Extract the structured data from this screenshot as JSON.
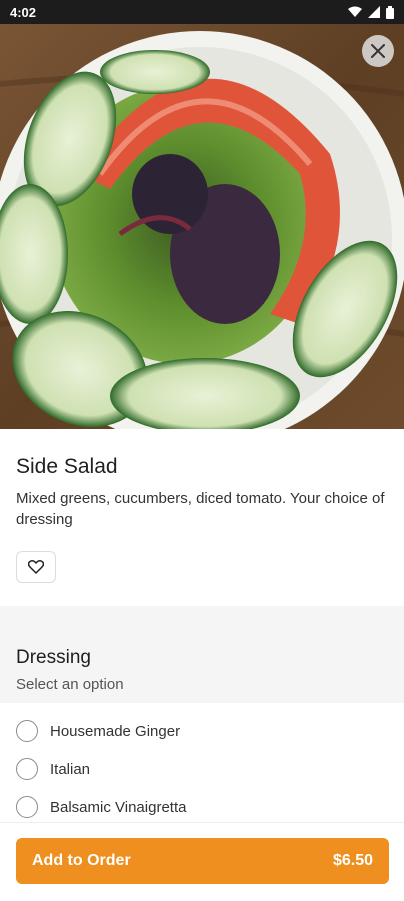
{
  "status_bar": {
    "time": "4:02",
    "icons": [
      "wifi-icon",
      "signal-icon",
      "battery-icon"
    ]
  },
  "hero": {
    "image": "side-salad-photo"
  },
  "close_button": {
    "icon": "close-icon"
  },
  "item": {
    "title": "Side Salad",
    "description": "Mixed greens, cucumbers, diced tomato. Your choice of dressing",
    "favorite_icon": "heart-icon"
  },
  "dressing": {
    "title": "Dressing",
    "subtitle": "Select an option",
    "options": [
      {
        "label": "Housemade Ginger"
      },
      {
        "label": "Italian"
      },
      {
        "label": "Balsamic Vinaigretta"
      }
    ]
  },
  "cart": {
    "add_label": "Add to Order",
    "price": "$6.50"
  },
  "colors": {
    "accent": "#ee8f1f",
    "status_bar": "#1c1c1c"
  }
}
